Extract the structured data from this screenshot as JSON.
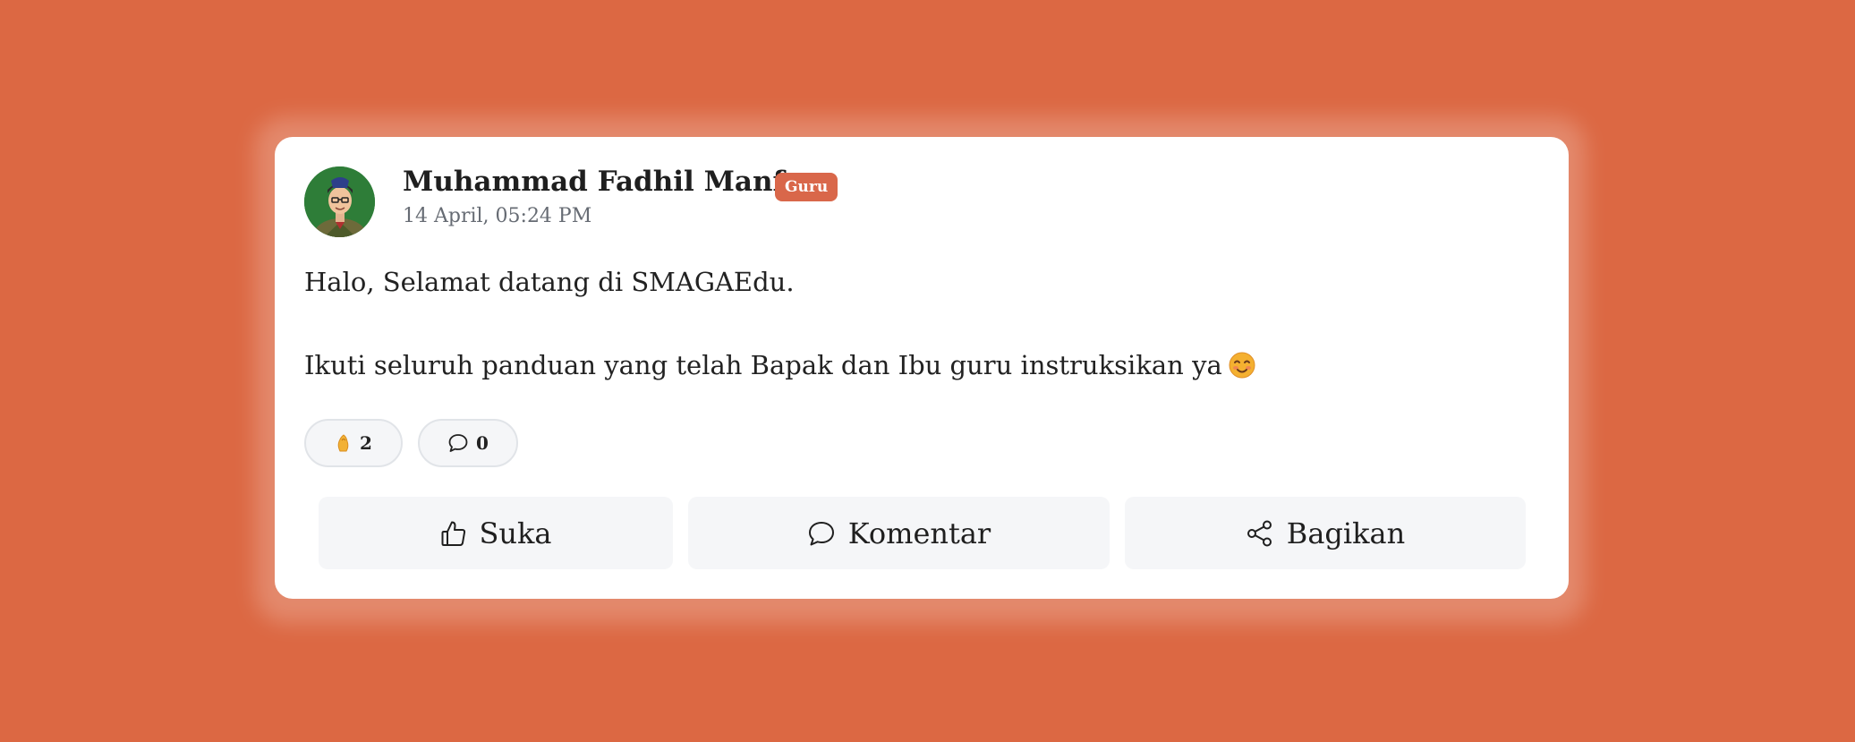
{
  "post": {
    "author": {
      "name": "Muhammad Fadhil Manfa",
      "role_badge": "Guru",
      "avatar_icon": "user-avatar"
    },
    "timestamp": "14 April, 05:24 PM",
    "body": {
      "line1": "Halo, Selamat datang di SMAGAEdu.",
      "line2": "Ikuti seluruh panduan yang telah Bapak dan Ibu guru instruksikan ya",
      "line2_emoji": "smiling-face-icon"
    },
    "reactions": {
      "likes_icon": "pinched-fingers-icon",
      "likes_count": "2",
      "comments_icon": "comment-bubble-icon",
      "comments_count": "0"
    },
    "actions": {
      "like_label": "Suka",
      "comment_label": "Komentar",
      "share_label": "Bagikan"
    }
  },
  "colors": {
    "background": "#dc6843",
    "badge": "#d9674a",
    "card": "#ffffff",
    "action_bg": "#f5f6f8"
  }
}
